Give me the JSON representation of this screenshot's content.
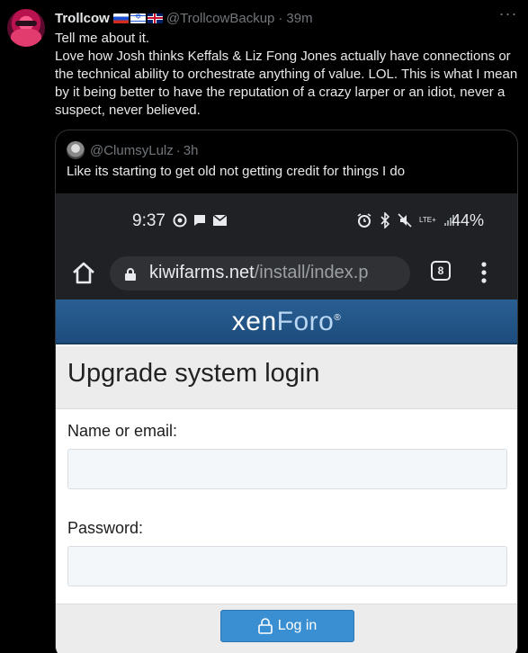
{
  "tweet": {
    "author_name": "Trollcow",
    "flags": [
      "russia-flag",
      "israel-flag",
      "uk-flag"
    ],
    "handle": "@TrollcowBackup",
    "separator": "·",
    "time": "39m",
    "more_label": "···",
    "text_line1": "Tell me about it.",
    "text_line2": "Love how Josh thinks Keffals & Liz Fong Jones actually have connections or the technical ability to orchestrate anything of value. LOL. This is what I mean by it being better to have the reputation of a crazy larper or an idiot, never a suspect, never believed."
  },
  "quote": {
    "handle": "@ClumsyLulz",
    "separator": "·",
    "time": "3h",
    "text": "Like its starting to get old not getting credit for things I do"
  },
  "phone": {
    "status_time": "9:37",
    "network": "LTE+",
    "battery": "44%",
    "url_host": "kiwifarms.net",
    "url_path": "/install/index.p",
    "tab_count": "8",
    "brand_part1": "xen",
    "brand_part2": "Foro",
    "brand_mark": "®",
    "page_title": "Upgrade system login",
    "name_label": "Name or email:",
    "password_label": "Password:",
    "login_label": "Log in"
  },
  "colors": {
    "background": "#000000",
    "text": "#e7e9ea",
    "muted": "#71767b",
    "xenforo_blue": "#2a5f93",
    "login_button": "#3a8fd3"
  }
}
